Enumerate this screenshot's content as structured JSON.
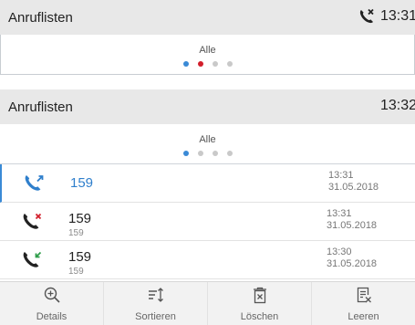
{
  "top_screen": {
    "title": "Anruflisten",
    "time": "13:31",
    "status_icon": "missed-call-indicator-icon",
    "tab_label": "Alle"
  },
  "bottom_screen": {
    "title": "Anruflisten",
    "time": "13:32",
    "tab_label": "Alle",
    "calls": [
      {
        "name": "159",
        "number": "",
        "time": "13:31",
        "date": "31.05.2018",
        "type": "outgoing",
        "icon": "outgoing-call-icon",
        "icon_color": "#2f7fcc"
      },
      {
        "name": "159",
        "number": "159",
        "time": "13:31",
        "date": "31.05.2018",
        "type": "missed",
        "icon": "missed-call-icon",
        "icon_color": "#d21e2b"
      },
      {
        "name": "159",
        "number": "159",
        "time": "13:30",
        "date": "31.05.2018",
        "type": "incoming",
        "icon": "incoming-call-icon",
        "icon_color": "#2e9d4a"
      }
    ],
    "toolbar": {
      "details": "Details",
      "sort": "Sortieren",
      "delete": "Löschen",
      "clear": "Leeren"
    }
  },
  "colors": {
    "accent_blue": "#3a8ad6",
    "missed_red": "#d21e2b",
    "header_bg": "#e8e8e8"
  }
}
